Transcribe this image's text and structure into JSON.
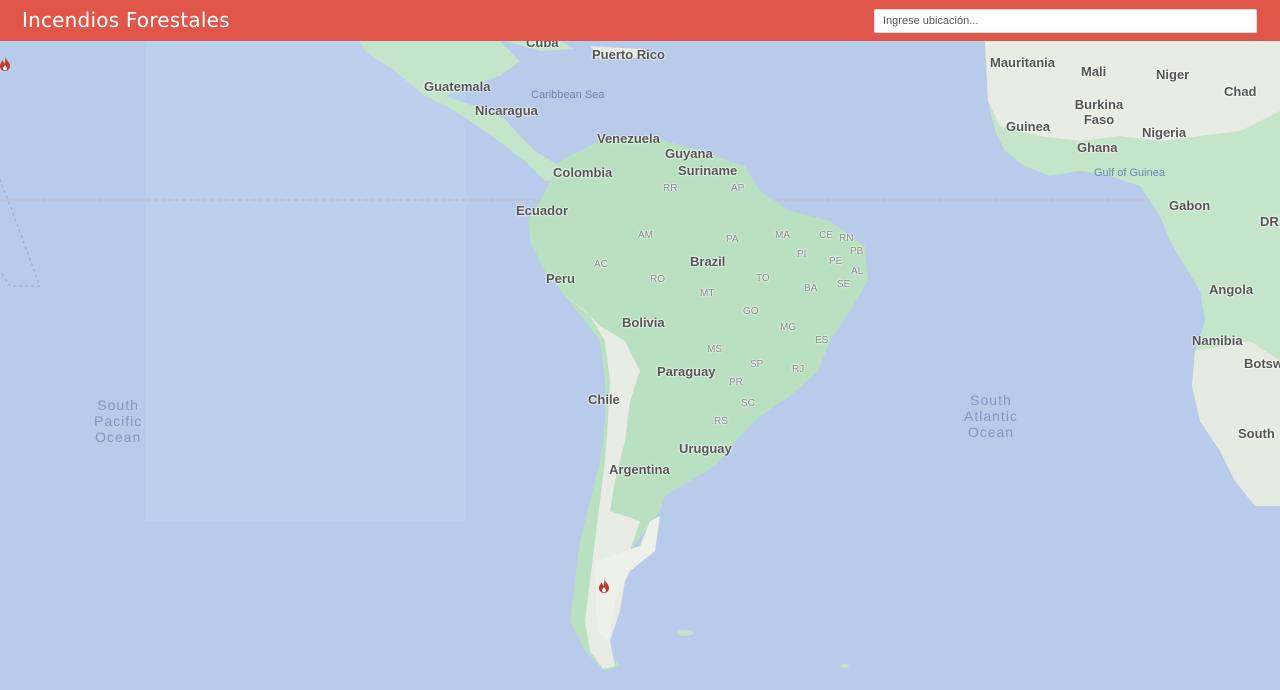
{
  "header": {
    "title": "Incendios Forestales"
  },
  "search": {
    "placeholder": "Ingrese ubicación..."
  },
  "map": {
    "colors": {
      "water": "#b7caea",
      "land": "#b9e0c0",
      "land_dry": "#e9ece4",
      "header": "#e0574a",
      "fire": "#c0392b"
    },
    "countries": [
      "Cuba",
      "Puerto Rico",
      "Guatemala",
      "Nicaragua",
      "Venezuela",
      "Guyana",
      "Suriname",
      "Colombia",
      "Ecuador",
      "Peru",
      "Brazil",
      "Bolivia",
      "Paraguay",
      "Chile",
      "Uruguay",
      "Argentina",
      "Mauritania",
      "Mali",
      "Niger",
      "Chad",
      "Burkina Faso",
      "Guinea",
      "Nigeria",
      "Ghana",
      "Gabon",
      "DR",
      "Angola",
      "Namibia",
      "Botsw",
      "South"
    ],
    "states": [
      "RR",
      "AP",
      "AM",
      "PA",
      "MA",
      "CE",
      "RN",
      "PB",
      "PI",
      "PE",
      "AL",
      "SE",
      "AC",
      "RO",
      "TO",
      "MT",
      "BA",
      "GO",
      "MG",
      "MS",
      "ES",
      "SP",
      "RJ",
      "PR",
      "SC",
      "RS"
    ],
    "seas": [
      "Caribbean Sea",
      "Gulf of Guinea"
    ],
    "oceans": [
      "South\nPacific\nOcean",
      "South\nAtlantic\nOcean"
    ],
    "fire_markers": [
      {
        "name": "fire-marker-patagonia"
      },
      {
        "name": "fire-marker-pacific"
      }
    ]
  }
}
